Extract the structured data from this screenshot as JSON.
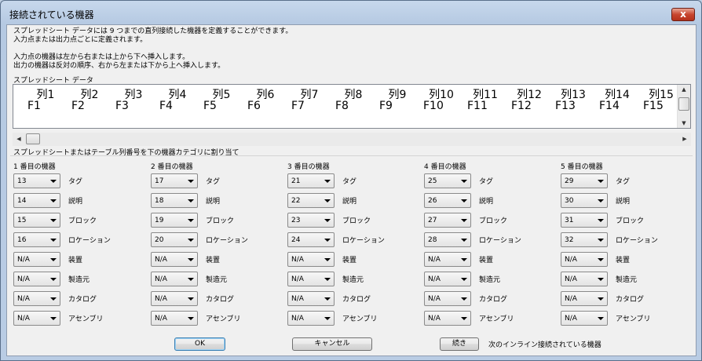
{
  "window": {
    "title": "接続されている機器",
    "close_glyph": "x"
  },
  "description": {
    "line1": "スプレッドシート データには 9 つまでの直列接続した機器を定義することができます。",
    "line2": "入力点または出力点ごとに定義されます。",
    "line3": "入力点の機器は左から右または上から下へ挿入します。",
    "line4": "出力の機器は反対の順序、右から左または下から上へ挿入します。"
  },
  "sheet": {
    "label": "スプレッドシート データ",
    "columns": [
      {
        "header": "列1",
        "field": "F1"
      },
      {
        "header": "列2",
        "field": "F2"
      },
      {
        "header": "列3",
        "field": "F3"
      },
      {
        "header": "列4",
        "field": "F4"
      },
      {
        "header": "列5",
        "field": "F5"
      },
      {
        "header": "列6",
        "field": "F6"
      },
      {
        "header": "列7",
        "field": "F7"
      },
      {
        "header": "列8",
        "field": "F8"
      },
      {
        "header": "列9",
        "field": "F9"
      },
      {
        "header": "列10",
        "field": "F10"
      },
      {
        "header": "列11",
        "field": "F11"
      },
      {
        "header": "列12",
        "field": "F12"
      },
      {
        "header": "列13",
        "field": "F13"
      },
      {
        "header": "列14",
        "field": "F14"
      },
      {
        "header": "列15",
        "field": "F15"
      }
    ],
    "scroll_up_glyph": "▲",
    "scroll_down_glyph": "▼",
    "scroll_left_glyph": "◀",
    "scroll_right_glyph": "▶"
  },
  "assign_label": "スプレッドシートまたはテーブル列番号を下の機器カテゴリに割り当て",
  "field_labels": [
    "タグ",
    "説明",
    "ブロック",
    "ロケーション",
    "装置",
    "製造元",
    "カタログ",
    "アセンブリ"
  ],
  "devices": [
    {
      "title": "1 番目の機器",
      "values": [
        "13",
        "14",
        "15",
        "16",
        "N/A",
        "N/A",
        "N/A",
        "N/A"
      ]
    },
    {
      "title": "2 番目の機器",
      "values": [
        "17",
        "18",
        "19",
        "20",
        "N/A",
        "N/A",
        "N/A",
        "N/A"
      ]
    },
    {
      "title": "3 番目の機器",
      "values": [
        "21",
        "22",
        "23",
        "24",
        "N/A",
        "N/A",
        "N/A",
        "N/A"
      ]
    },
    {
      "title": "4 番目の機器",
      "values": [
        "25",
        "26",
        "27",
        "28",
        "N/A",
        "N/A",
        "N/A",
        "N/A"
      ]
    },
    {
      "title": "5 番目の機器",
      "values": [
        "29",
        "30",
        "31",
        "32",
        "N/A",
        "N/A",
        "N/A",
        "N/A"
      ]
    }
  ],
  "buttons": {
    "ok": "OK",
    "cancel": "キャンセル",
    "continue": "続き"
  },
  "next_label": "次のインライン接続されている機器",
  "colors": {
    "title_bar": "#bfcfe3",
    "dialog_bg": "#f0f0f0",
    "close_button": "#c8452e",
    "default_button_border": "#3c7fb1"
  }
}
